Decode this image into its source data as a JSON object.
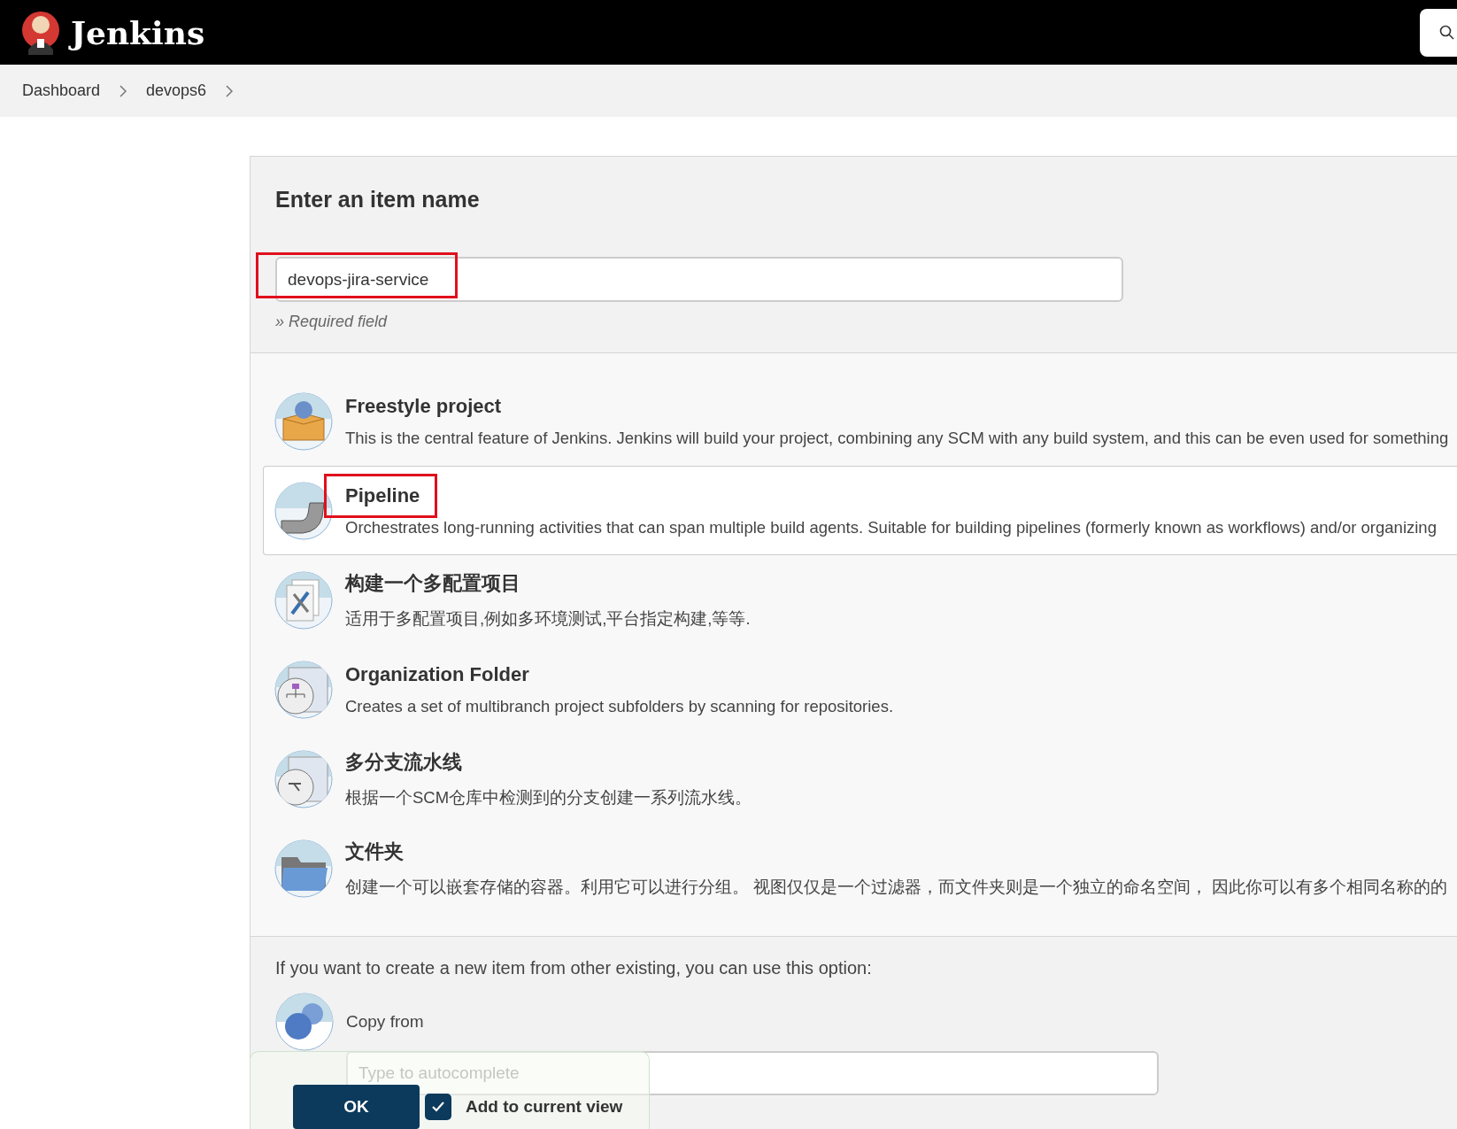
{
  "header": {
    "title": "Jenkins"
  },
  "breadcrumbs": [
    "Dashboard",
    "devops6"
  ],
  "name_section": {
    "heading": "Enter an item name",
    "value": "devops-jira-service",
    "highlighted": true,
    "hint": "» Required field"
  },
  "item_types": [
    {
      "kind": "freestyle",
      "title": "Freestyle project",
      "description": "This is the central feature of Jenkins. Jenkins will build your project, combining any SCM with any build system, and this can be even used for something",
      "selected": false,
      "highlighted": false
    },
    {
      "kind": "pipeline",
      "title": "Pipeline",
      "description": "Orchestrates long-running activities that can span multiple build agents. Suitable for building pipelines (formerly known as workflows) and/or organizing",
      "selected": true,
      "highlighted": true
    },
    {
      "kind": "multiconfig",
      "title": "构建一个多配置项目",
      "description": "适用于多配置项目,例如多环境测试,平台指定构建,等等.",
      "selected": false,
      "highlighted": false
    },
    {
      "kind": "orgfolder",
      "title": "Organization Folder",
      "description": "Creates a set of multibranch project subfolders by scanning for repositories.",
      "selected": false,
      "highlighted": false
    },
    {
      "kind": "multibranch",
      "title": "多分支流水线",
      "description": "根据一个SCM仓库中检测到的分支创建一系列流水线。",
      "selected": false,
      "highlighted": false
    },
    {
      "kind": "folder",
      "title": "文件夹",
      "description": "创建一个可以嵌套存储的容器。利用它可以进行分组。 视图仅仅是一个过滤器，而文件夹则是一个独立的命名空间， 因此你可以有多个相同名称的的",
      "selected": false,
      "highlighted": false
    }
  ],
  "copy_section": {
    "prompt": "If you want to create a new item from other existing, you can use this option:",
    "label": "Copy from",
    "placeholder": "Type to autocomplete"
  },
  "footer": {
    "ok_label": "OK",
    "add_to_view": {
      "label": "Add to current view",
      "checked": true
    }
  }
}
